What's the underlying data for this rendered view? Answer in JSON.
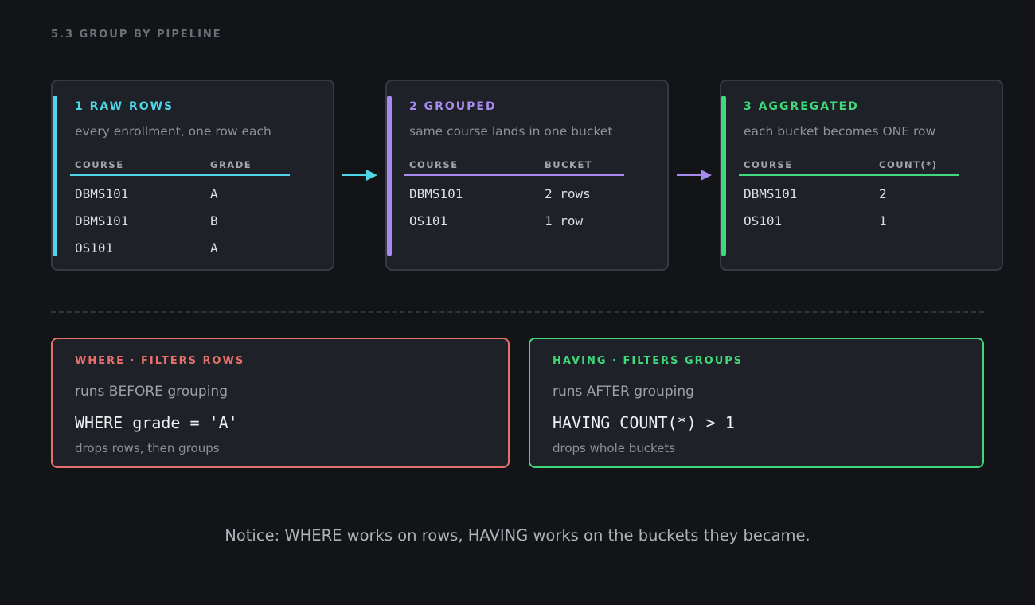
{
  "section_label": "5.3  GROUP BY PIPELINE",
  "colors": {
    "raw": "#4fd6e6",
    "grouped": "#a98bf0",
    "aggregated": "#3fd97a",
    "where": "#e8706c",
    "having": "#3fd97a"
  },
  "stages": [
    {
      "title": "1  RAW ROWS",
      "subtitle": "every enrollment, one row each",
      "headers": [
        "COURSE",
        "GRADE"
      ],
      "rows": [
        [
          "DBMS101",
          "A"
        ],
        [
          "DBMS101",
          "B"
        ],
        [
          "OS101",
          "A"
        ]
      ]
    },
    {
      "title": "2  GROUPED",
      "subtitle": "same course lands in one bucket",
      "headers": [
        "COURSE",
        "BUCKET"
      ],
      "rows": [
        [
          "DBMS101",
          "2 rows"
        ],
        [
          "OS101",
          "1 row"
        ]
      ]
    },
    {
      "title": "3  AGGREGATED",
      "subtitle": "each bucket becomes ONE row",
      "headers": [
        "COURSE",
        "COUNT(*)"
      ],
      "rows": [
        [
          "DBMS101",
          "2"
        ],
        [
          "OS101",
          "1"
        ]
      ]
    }
  ],
  "filters": {
    "where": {
      "title": "WHERE  ·  FILTERS ROWS",
      "subtitle": "runs BEFORE grouping",
      "code": "WHERE grade = 'A'",
      "note": "drops rows, then groups"
    },
    "having": {
      "title": "HAVING  ·  FILTERS GROUPS",
      "subtitle": "runs AFTER grouping",
      "code": "HAVING COUNT(*) > 1",
      "note": "drops whole buckets"
    }
  },
  "notice": "Notice: WHERE works on rows, HAVING works on the buckets they became."
}
